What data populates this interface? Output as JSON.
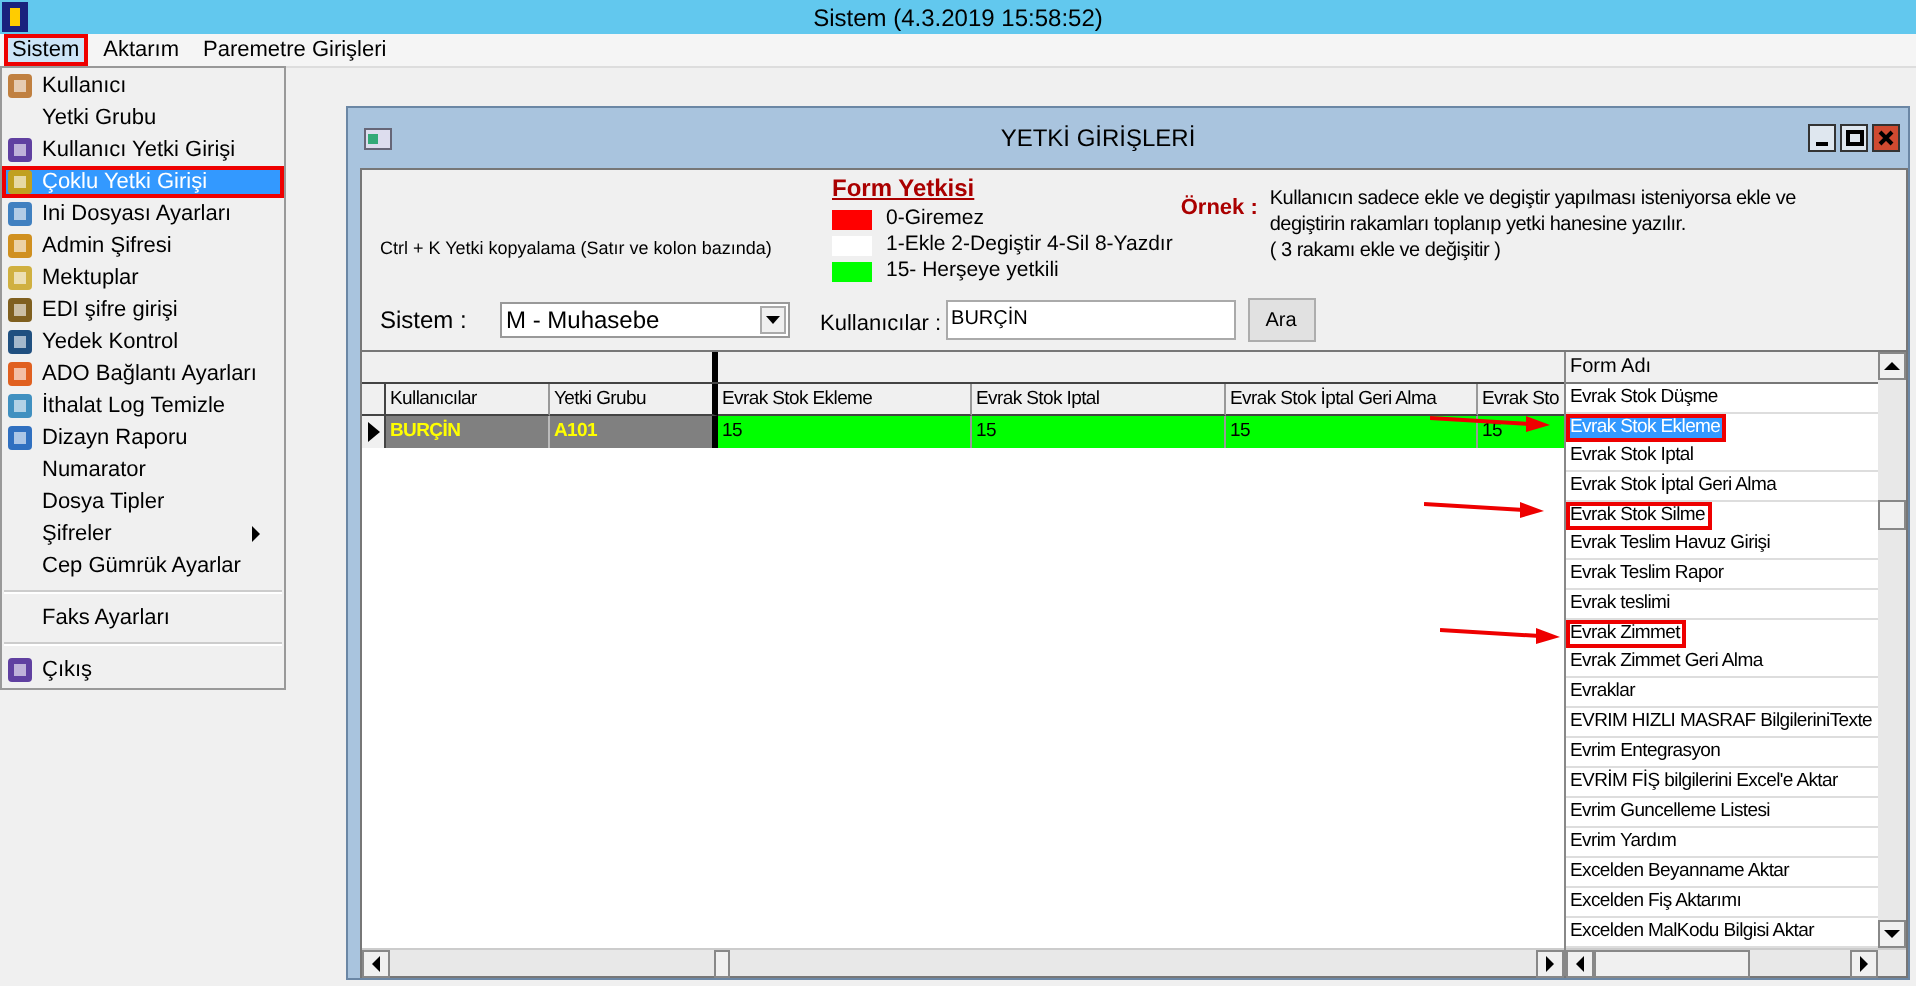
{
  "app": {
    "title": "Sistem (4.3.2019 15:58:52)"
  },
  "menu_bar": [
    {
      "label": "Sistem",
      "selected": true,
      "highlighted": true
    },
    {
      "label": "Aktarım",
      "selected": false,
      "highlighted": false
    },
    {
      "label": "Paremetre Girişleri",
      "selected": false,
      "highlighted": false
    }
  ],
  "dropdown": [
    {
      "kind": "item",
      "label": "Kullanıcı",
      "has_icon": true,
      "submenu": false,
      "selected": false,
      "highlighted": false
    },
    {
      "kind": "item",
      "label": "Yetki Grubu",
      "has_icon": false,
      "submenu": false,
      "selected": false,
      "highlighted": false
    },
    {
      "kind": "item",
      "label": "Kullanıcı Yetki Girişi",
      "has_icon": true,
      "submenu": false,
      "selected": false,
      "highlighted": false
    },
    {
      "kind": "item",
      "label": "Çoklu Yetki Girişi",
      "has_icon": true,
      "submenu": false,
      "selected": true,
      "highlighted": true
    },
    {
      "kind": "item",
      "label": "Ini Dosyası  Ayarları",
      "has_icon": true,
      "submenu": false,
      "selected": false,
      "highlighted": false
    },
    {
      "kind": "item",
      "label": "Admin Şifresi",
      "has_icon": true,
      "submenu": false,
      "selected": false,
      "highlighted": false
    },
    {
      "kind": "item",
      "label": "Mektuplar",
      "has_icon": true,
      "submenu": false,
      "selected": false,
      "highlighted": false
    },
    {
      "kind": "item",
      "label": "EDI şifre girişi",
      "has_icon": true,
      "submenu": false,
      "selected": false,
      "highlighted": false
    },
    {
      "kind": "item",
      "label": "Yedek Kontrol",
      "has_icon": true,
      "submenu": false,
      "selected": false,
      "highlighted": false
    },
    {
      "kind": "item",
      "label": "ADO Bağlantı Ayarları",
      "has_icon": true,
      "submenu": false,
      "selected": false,
      "highlighted": false
    },
    {
      "kind": "item",
      "label": "İthalat Log Temizle",
      "has_icon": true,
      "submenu": false,
      "selected": false,
      "highlighted": false
    },
    {
      "kind": "item",
      "label": "Dizayn Raporu",
      "has_icon": true,
      "submenu": false,
      "selected": false,
      "highlighted": false
    },
    {
      "kind": "item",
      "label": "Numarator",
      "has_icon": false,
      "submenu": false,
      "selected": false,
      "highlighted": false
    },
    {
      "kind": "item",
      "label": "Dosya Tipler",
      "has_icon": false,
      "submenu": false,
      "selected": false,
      "highlighted": false
    },
    {
      "kind": "item",
      "label": "Şifreler",
      "has_icon": false,
      "submenu": true,
      "selected": false,
      "highlighted": false
    },
    {
      "kind": "item",
      "label": "Cep Gümrük Ayarlar",
      "has_icon": false,
      "submenu": false,
      "selected": false,
      "highlighted": false
    },
    {
      "kind": "separator"
    },
    {
      "kind": "item",
      "label": "Faks Ayarları",
      "has_icon": false,
      "submenu": false,
      "selected": false,
      "highlighted": false
    },
    {
      "kind": "separator"
    },
    {
      "kind": "item",
      "label": "Çıkış",
      "has_icon": true,
      "submenu": false,
      "selected": false,
      "highlighted": false
    }
  ],
  "window": {
    "title": "YETKİ GİRİŞLERİ",
    "copy_hint": "Ctrl + K Yetki kopyalama (Satır ve kolon bazında)",
    "legend": {
      "title": "Form Yetkisi",
      "items": [
        {
          "label": "0-Giremez",
          "color": "#ff0000"
        },
        {
          "label": "1-Ekle  2-Degiştir  4-Sil  8-Yazdır",
          "color": "#ffffff"
        },
        {
          "label": "15- Herşeye yetkili",
          "color": "#00ff00"
        }
      ]
    },
    "example": {
      "label": "Örnek :",
      "lines": [
        "Kullanıcın sadece ekle ve degiştir yapılması isteniyorsa  ekle ve",
        "degiştirin rakamları toplanıp yetki hanesine yazılır.",
        "( 3 rakamı ekle ve değişitir )"
      ]
    },
    "sistem": {
      "label": "Sistem :",
      "value": "M - Muhasebe"
    },
    "users": {
      "label": "Kullanıcılar :",
      "value": "BURÇİN"
    },
    "search_button": "Ara",
    "grid": {
      "columns": [
        "Kullanıcılar",
        "Yetki Grubu",
        "Evrak Stok Ekleme",
        "Evrak Stok Iptal",
        "Evrak Stok İptal Geri Alma",
        "Evrak Sto"
      ],
      "rows": [
        {
          "selected": true,
          "cells": [
            "BURÇİN",
            "A101",
            "15",
            "15",
            "15",
            "15"
          ]
        }
      ]
    },
    "form_list": {
      "header": "Form Adı",
      "items": [
        {
          "label": "Evrak Stok Düşme",
          "selected": false,
          "highlighted": false
        },
        {
          "label": "Evrak Stok Ekleme",
          "selected": true,
          "highlighted": true
        },
        {
          "label": "Evrak Stok Iptal",
          "selected": false,
          "highlighted": false
        },
        {
          "label": "Evrak Stok İptal Geri Alma",
          "selected": false,
          "highlighted": false
        },
        {
          "label": "Evrak Stok Silme",
          "selected": false,
          "highlighted": true
        },
        {
          "label": "Evrak Teslim Havuz Girişi",
          "selected": false,
          "highlighted": false
        },
        {
          "label": "Evrak Teslim Rapor",
          "selected": false,
          "highlighted": false
        },
        {
          "label": "Evrak teslimi",
          "selected": false,
          "highlighted": false
        },
        {
          "label": "Evrak Zimmet",
          "selected": false,
          "highlighted": true
        },
        {
          "label": "Evrak Zimmet Geri Alma",
          "selected": false,
          "highlighted": false
        },
        {
          "label": "Evraklar",
          "selected": false,
          "highlighted": false
        },
        {
          "label": "EVRIM  HIZLI MASRAF BilgileriniTexte",
          "selected": false,
          "highlighted": false
        },
        {
          "label": "Evrim Entegrasyon",
          "selected": false,
          "highlighted": false
        },
        {
          "label": "EVRİM FİŞ bilgilerini Excel'e Aktar",
          "selected": false,
          "highlighted": false
        },
        {
          "label": "Evrim Guncelleme Listesi",
          "selected": false,
          "highlighted": false
        },
        {
          "label": "Evrim Yardım",
          "selected": false,
          "highlighted": false
        },
        {
          "label": "Excelden Beyanname Aktar",
          "selected": false,
          "highlighted": false
        },
        {
          "label": "Excelden Fiş Aktarımı",
          "selected": false,
          "highlighted": false
        },
        {
          "label": "Excelden MalKodu Bilgisi Aktar",
          "selected": false,
          "highlighted": false
        }
      ]
    }
  }
}
